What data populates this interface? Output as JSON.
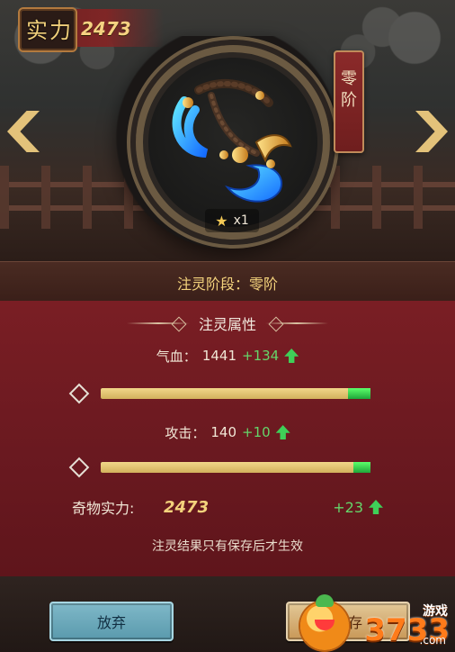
{
  "strength": {
    "badge_text": "实力",
    "value": "2473"
  },
  "artifact": {
    "star_count_label": "x1"
  },
  "stage_tag": {
    "text": "零阶"
  },
  "stage_banner": {
    "text": "注灵阶段：零阶"
  },
  "attributes": {
    "title": "注灵属性",
    "hp": {
      "label": "气血：",
      "value": "1441",
      "gain": "+134",
      "bar_base_fraction": 0.915,
      "bar_gain_fraction": 0.085
    },
    "atk": {
      "label": "攻击：",
      "value": "140",
      "gain": "+10",
      "bar_base_fraction": 0.935,
      "bar_gain_fraction": 0.065
    }
  },
  "artifact_power": {
    "label": "奇物实力:",
    "value": "2473",
    "gain": "+23"
  },
  "note": "注灵结果只有保存后才生效",
  "buttons": {
    "cancel": "放弃",
    "save": "保存"
  },
  "watermark": {
    "big": "3733",
    "small": "游戏",
    "domain": ".com"
  },
  "colors": {
    "accent_gold": "#f3d27c",
    "panel_red": "#7a1e24",
    "gain_green": "#65d56a"
  },
  "icons": {
    "left_nav": "chevron-left-icon",
    "right_nav": "chevron-right-icon",
    "star": "star-icon",
    "up": "arrow-up-icon"
  }
}
